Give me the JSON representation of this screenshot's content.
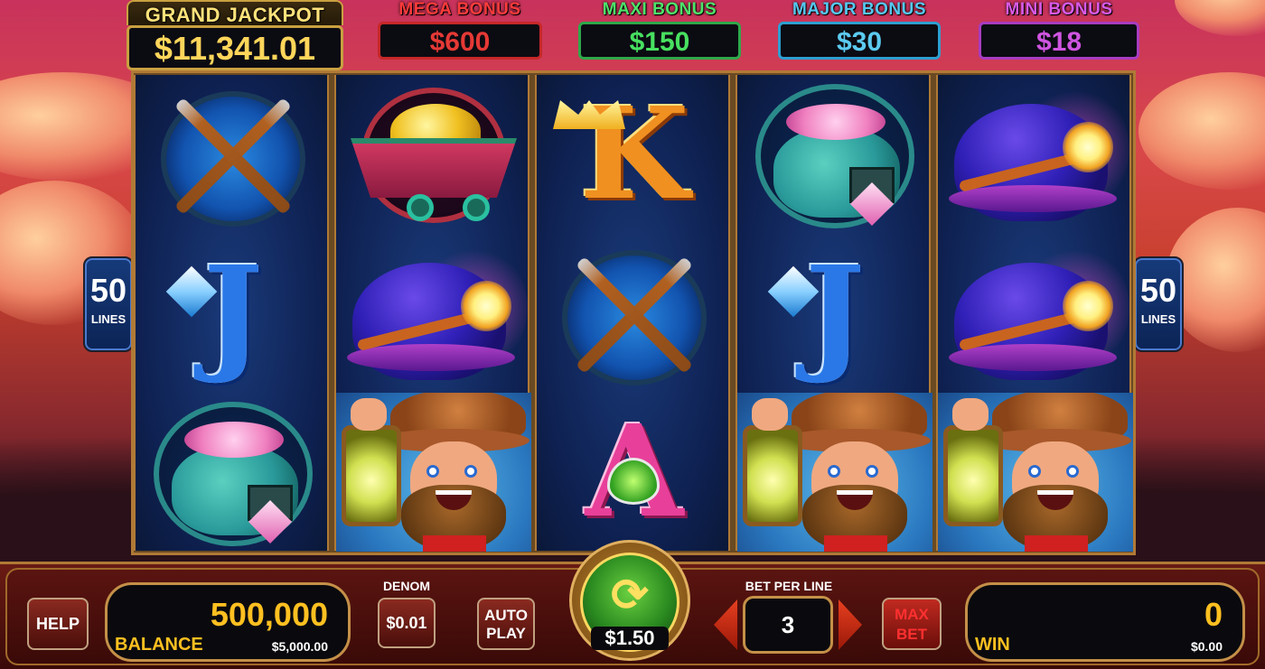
{
  "jackpots": {
    "grand": {
      "label": "GRAND JACKPOT",
      "value": "$11,341.01",
      "color": "#ffd65a"
    },
    "mega": {
      "label": "MEGA BONUS",
      "value": "$600",
      "color": "#e53935"
    },
    "maxi": {
      "label": "MAXI BONUS",
      "value": "$150",
      "color": "#48e060"
    },
    "major": {
      "label": "MAJOR BONUS",
      "value": "$30",
      "color": "#5ccaf0"
    },
    "mini": {
      "label": "MINI BONUS",
      "value": "$18",
      "color": "#cf55e0"
    }
  },
  "lines": {
    "count": "50",
    "label": "LINES"
  },
  "reels": [
    [
      "pickaxe-shovel",
      "letter-j",
      "gem-bag"
    ],
    [
      "mine-cart-gold",
      "miner-helmet",
      "miner"
    ],
    [
      "letter-k",
      "pickaxe-shovel",
      "letter-a"
    ],
    [
      "gem-bag",
      "letter-j",
      "miner"
    ],
    [
      "miner-helmet",
      "miner-helmet",
      "miner"
    ]
  ],
  "symbols": {
    "j": "J",
    "k": "K",
    "a": "A"
  },
  "controls": {
    "help_label": "HELP",
    "balance_value": "500,000",
    "balance_label": "BALANCE",
    "balance_cash": "$5,000.00",
    "denom_label": "DENOM",
    "denom_value": "$0.01",
    "auto_label_1": "AUTO",
    "auto_label_2": "PLAY",
    "spin_bet": "$1.50",
    "bet_per_line_label": "BET PER LINE",
    "bet_per_line_value": "3",
    "max_label_1": "MAX",
    "max_label_2": "BET",
    "win_value": "0",
    "win_label": "WIN",
    "win_cash": "$0.00"
  }
}
